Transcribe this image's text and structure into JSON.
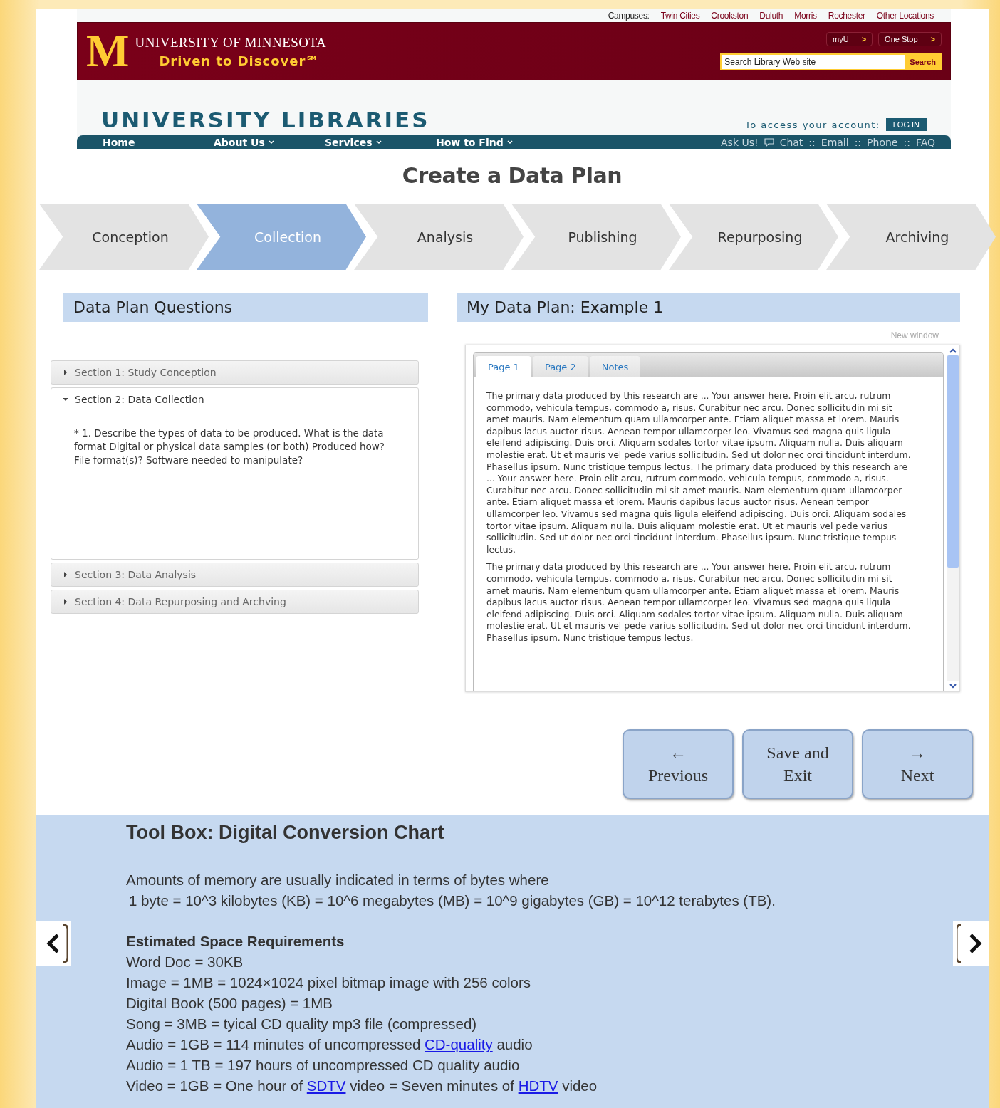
{
  "campuses": {
    "label": "Campuses:",
    "links": [
      "Twin Cities",
      "Crookston",
      "Duluth",
      "Morris",
      "Rochester",
      "Other Locations"
    ]
  },
  "banner": {
    "logo_mark": "M",
    "name": "UNIVERSITY OF MINNESOTA",
    "tagline": "Driven to Discover℠",
    "buttons": [
      {
        "label": "myU",
        "arrow": ">"
      },
      {
        "label": "One Stop",
        "arrow": ">"
      }
    ],
    "search": {
      "placeholder": "Search Library Web site",
      "button": "Search"
    }
  },
  "libraries": {
    "title": "UNIVERSITY LIBRARIES",
    "account_label": "To access your account:",
    "login": "LOG IN"
  },
  "nav": {
    "items": [
      {
        "label": "Home",
        "dropdown": false
      },
      {
        "label": "About Us",
        "dropdown": true
      },
      {
        "label": "Services",
        "dropdown": true
      },
      {
        "label": "How to Find",
        "dropdown": true
      }
    ],
    "help": [
      {
        "kind": "label",
        "label": "Ask Us!"
      },
      {
        "kind": "icon"
      },
      {
        "kind": "link",
        "label": "Chat"
      },
      {
        "kind": "sep",
        "label": "::"
      },
      {
        "kind": "link",
        "label": "Email"
      },
      {
        "kind": "sep",
        "label": "::"
      },
      {
        "kind": "link",
        "label": "Phone"
      },
      {
        "kind": "sep",
        "label": "::"
      },
      {
        "kind": "link",
        "label": "FAQ"
      }
    ]
  },
  "page_title": "Create a Data Plan",
  "steps": [
    {
      "label": "Conception",
      "selected": false
    },
    {
      "label": "Collection",
      "selected": true
    },
    {
      "label": "Analysis",
      "selected": false
    },
    {
      "label": "Publishing",
      "selected": false
    },
    {
      "label": "Repurposing",
      "selected": false
    },
    {
      "label": "Archiving",
      "selected": false
    }
  ],
  "questions": {
    "heading": "Data Plan Questions",
    "sections": [
      {
        "title": "Section 1: Study Conception",
        "expanded": false
      },
      {
        "title": "Section 2: Data Collection",
        "expanded": true,
        "question": "* 1. Describe the types of data to be produced. What is the data format Digital or physical data samples (or both) Produced how? File format(s)? Software needed to manipulate?"
      },
      {
        "title": "Section 3: Data Analysis",
        "expanded": false
      },
      {
        "title": "Section 4: Data Repurposing and Archving",
        "expanded": false
      }
    ]
  },
  "plan": {
    "heading": "My Data Plan: Example 1",
    "new_window": "New window",
    "tabs": [
      {
        "label": "Page 1",
        "selected": true
      },
      {
        "label": "Page 2",
        "selected": false
      },
      {
        "label": "Notes",
        "selected": false
      }
    ],
    "paragraphs": [
      "The primary data produced by this research are ... Your answer here. Proin elit arcu, rutrum commodo, vehicula tempus, commodo a, risus. Curabitur nec arcu. Donec sollicitudin mi sit amet mauris. Nam elementum quam ullamcorper ante. Etiam aliquet massa et lorem. Mauris dapibus lacus auctor risus. Aenean tempor ullamcorper leo. Vivamus sed magna quis ligula eleifend adipiscing. Duis orci. Aliquam sodales tortor vitae ipsum. Aliquam nulla. Duis aliquam molestie erat. Ut et mauris vel pede varius sollicitudin. Sed ut dolor nec orci tincidunt interdum. Phasellus ipsum. Nunc tristique tempus lectus. The primary data produced by this research are ... Your answer here. Proin elit arcu, rutrum commodo, vehicula tempus, commodo a, risus. Curabitur nec arcu. Donec sollicitudin mi sit amet mauris. Nam elementum quam ullamcorper ante. Etiam aliquet massa et lorem. Mauris dapibus lacus auctor risus. Aenean tempor ullamcorper leo. Vivamus sed magna quis ligula eleifend adipiscing. Duis orci. Aliquam sodales tortor vitae ipsum. Aliquam nulla. Duis aliquam molestie erat. Ut et mauris vel pede varius sollicitudin. Sed ut dolor nec orci tincidunt interdum. Phasellus ipsum. Nunc tristique tempus lectus.",
      "The primary data produced by this research are ... Your answer here. Proin elit arcu, rutrum commodo, vehicula tempus, commodo a, risus. Curabitur nec arcu. Donec sollicitudin mi sit amet mauris. Nam elementum quam ullamcorper ante. Etiam aliquet massa et lorem. Mauris dapibus lacus auctor risus. Aenean tempor ullamcorper leo. Vivamus sed magna quis ligula eleifend adipiscing. Duis orci. Aliquam sodales tortor vitae ipsum. Aliquam nulla. Duis aliquam molestie erat. Ut et mauris vel pede varius sollicitudin. Sed ut dolor nec orci tincidunt interdum. Phasellus ipsum. Nunc tristique tempus lectus."
    ]
  },
  "buttons": [
    {
      "kind": "previous",
      "arrow": "←",
      "label": "Previous"
    },
    {
      "kind": "save",
      "label": "Save and Exit"
    },
    {
      "kind": "next",
      "arrow": "→",
      "label": "Next"
    }
  ],
  "toolbox": {
    "title": "Tool Box: Digital Conversion Chart",
    "intro": [
      "Amounts of memory are usually indicated in terms of bytes where",
      "1 byte = 10^3 kilobytes (KB) = 10^6 megabytes (MB) = 10^9 gigabytes (GB) = 10^12 terabytes (TB)."
    ],
    "heading": "Estimated Space Requirements",
    "lines": [
      [
        {
          "text": "Word Doc = 30KB",
          "link": false
        }
      ],
      [
        {
          "text": "Image = 1MB = 1024×1024 pixel bitmap image with 256 colors",
          "link": false
        }
      ],
      [
        {
          "text": "Digital Book (500 pages) = 1MB",
          "link": false
        }
      ],
      [
        {
          "text": "Song = 3MB = tyical CD quality mp3 file (compressed)",
          "link": false
        }
      ],
      [
        {
          "text": "Audio = 1GB = 114 minutes of uncompressed",
          "link": false
        },
        {
          "text": "CD-quality",
          "link": true
        },
        {
          "text": "audio",
          "link": false
        }
      ],
      [
        {
          "text": "Audio = 1 TB = 197 hours of uncompressed CD quality audio",
          "link": false
        }
      ],
      [
        {
          "text": "Video = 1GB = One hour of",
          "link": false
        },
        {
          "text": "SDTV",
          "link": true
        },
        {
          "text": "video = Seven minutes of",
          "link": false
        },
        {
          "text": "HDTV",
          "link": true
        },
        {
          "text": "video",
          "link": false
        }
      ]
    ]
  }
}
